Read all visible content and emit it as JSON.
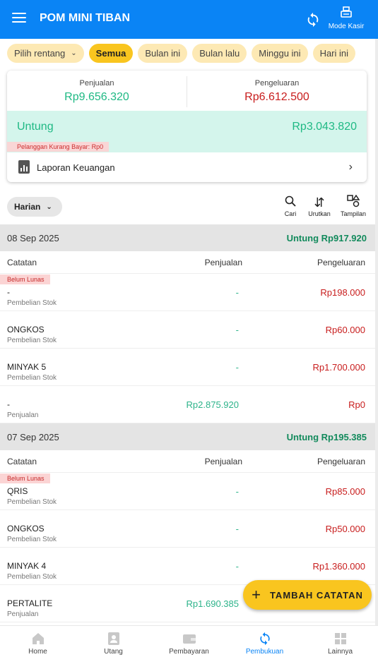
{
  "appbar": {
    "title": "POM MINI TIBAN",
    "kasir_label": "Mode Kasir"
  },
  "filters": [
    {
      "label": "Pilih rentang",
      "has_dropdown": true,
      "active": false
    },
    {
      "label": "Semua",
      "active": true
    },
    {
      "label": "Bulan ini",
      "active": false
    },
    {
      "label": "Bulan lalu",
      "active": false
    },
    {
      "label": "Minggu ini",
      "active": false
    },
    {
      "label": "Hari ini",
      "active": false
    }
  ],
  "summary": {
    "sales_label": "Penjualan",
    "sales_value": "Rp9.656.320",
    "expense_label": "Pengeluaran",
    "expense_value": "Rp6.612.500",
    "profit_label": "Untung",
    "profit_value": "Rp3.043.820",
    "unpaid_note": "Pelanggan Kurang Bayar: Rp0",
    "report_label": "Laporan Keuangan"
  },
  "toolbar": {
    "period": "Harian",
    "search": "Cari",
    "sort": "Urutkan",
    "view": "Tampilan"
  },
  "columns": {
    "note": "Catatan",
    "sales": "Penjualan",
    "expense": "Pengeluaran"
  },
  "days": [
    {
      "date": "08 Sep 2025",
      "profit": "Untung Rp917.920",
      "rows": [
        {
          "badge": "Belum Lunas",
          "name": "-",
          "type": "Pembelian Stok",
          "sale": "-",
          "expense": "Rp198.000"
        },
        {
          "badge": "",
          "name": "ONGKOS",
          "type": "Pembelian Stok",
          "sale": "-",
          "expense": "Rp60.000"
        },
        {
          "badge": "",
          "name": "MINYAK 5",
          "type": "Pembelian Stok",
          "sale": "-",
          "expense": "Rp1.700.000"
        },
        {
          "badge": "",
          "name": "-",
          "type": "Penjualan",
          "sale": "Rp2.875.920",
          "expense": "Rp0"
        }
      ]
    },
    {
      "date": "07 Sep 2025",
      "profit": "Untung Rp195.385",
      "rows": [
        {
          "badge": "Belum Lunas",
          "name": "QRIS",
          "type": "Pembelian Stok",
          "sale": "-",
          "expense": "Rp85.000"
        },
        {
          "badge": "",
          "name": "ONGKOS",
          "type": "Pembelian Stok",
          "sale": "-",
          "expense": "Rp50.000"
        },
        {
          "badge": "",
          "name": "MINYAK 4",
          "type": "Pembelian Stok",
          "sale": "-",
          "expense": "Rp1.360.000"
        },
        {
          "badge": "",
          "name": "PERTALITE",
          "type": "Penjualan",
          "sale": "Rp1.690.385",
          "expense": ""
        }
      ]
    }
  ],
  "fab_label": "TAMBAH CATATAN",
  "nav": [
    {
      "label": "Home",
      "icon": "home-icon",
      "active": false
    },
    {
      "label": "Utang",
      "icon": "person-icon",
      "active": false
    },
    {
      "label": "Pembayaran",
      "icon": "wallet-icon",
      "active": false
    },
    {
      "label": "Pembukuan",
      "icon": "sync-book-icon",
      "active": true
    },
    {
      "label": "Lainnya",
      "icon": "grid-icon",
      "active": false
    }
  ],
  "colors": {
    "primary": "#0a84f5",
    "accent": "#f9c51f",
    "profit": "#1fb984",
    "expense": "#c81d1d"
  }
}
